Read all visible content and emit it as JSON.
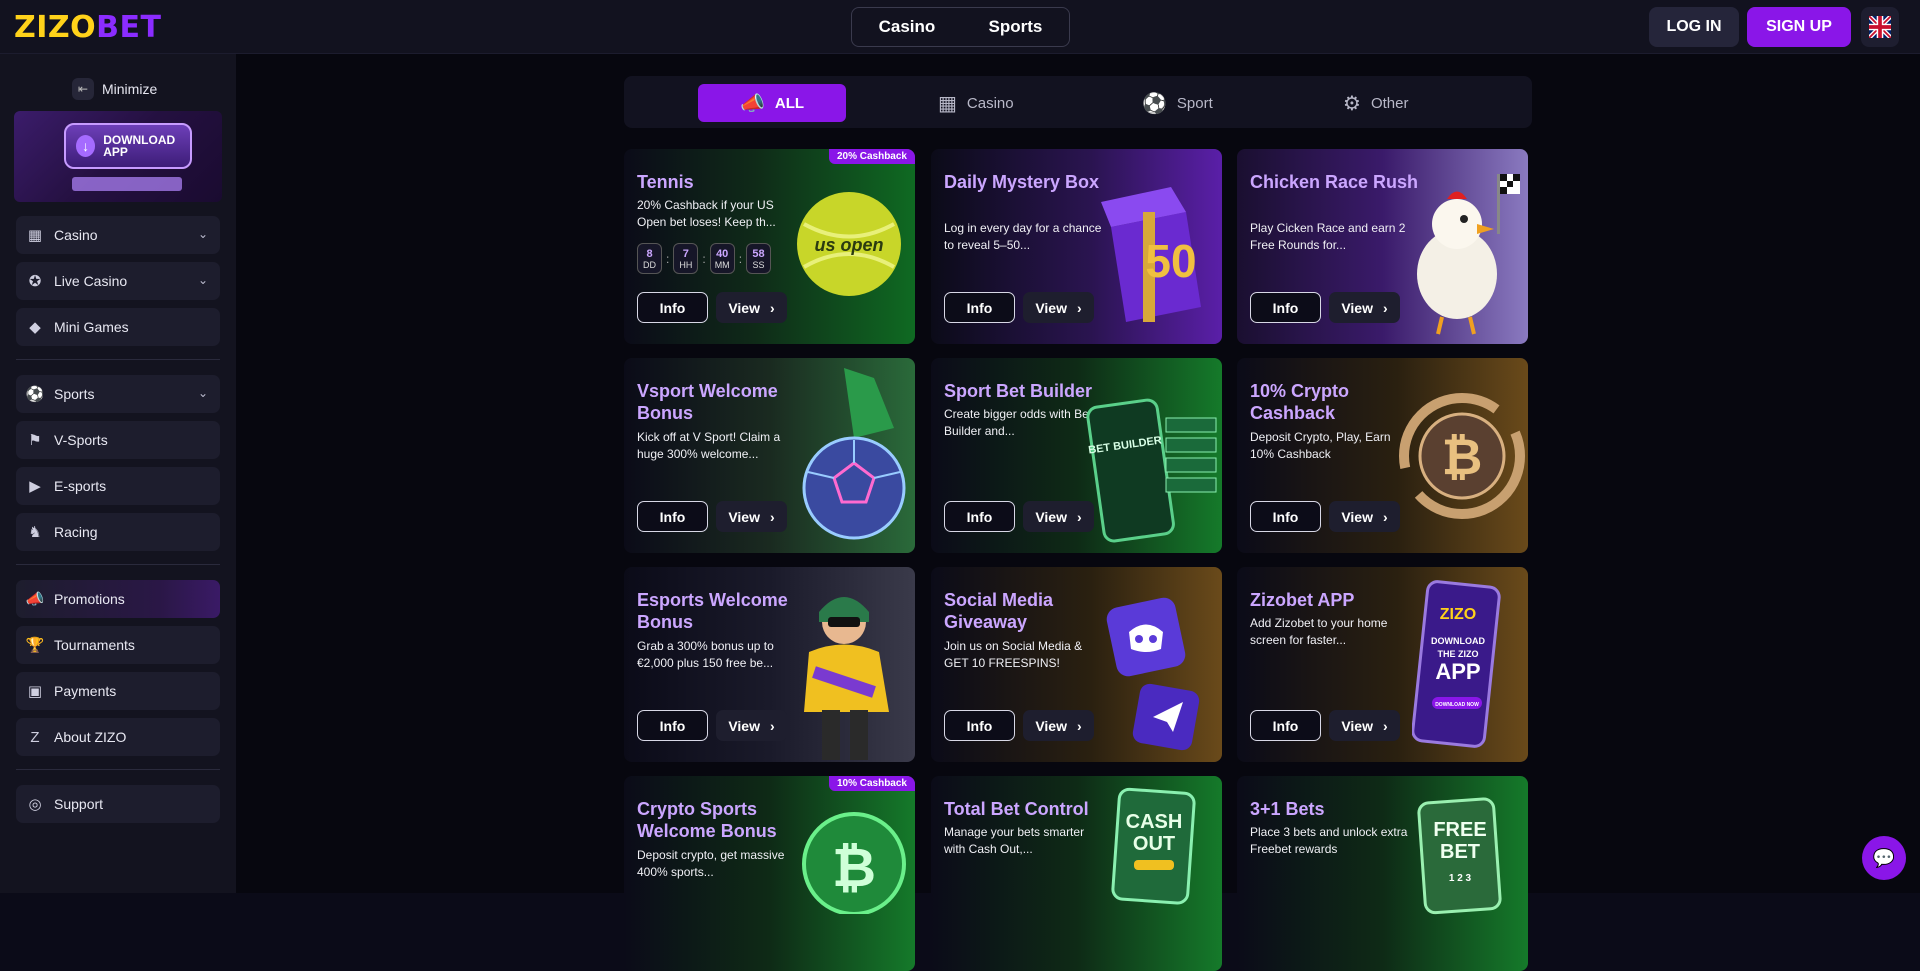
{
  "header": {
    "logo_part1": "ZIZO",
    "logo_part2": "BET",
    "nav": [
      "Casino",
      "Sports"
    ],
    "login": "LOG IN",
    "signup": "SIGN UP",
    "flag_icon": "uk-flag-icon"
  },
  "sidebar": {
    "minimize": "Minimize",
    "download": "DOWNLOAD APP",
    "items": [
      {
        "label": "Casino",
        "icon": "casino-icon",
        "chevron": true
      },
      {
        "label": "Live Casino",
        "icon": "live-casino-icon",
        "chevron": true
      },
      {
        "label": "Mini Games",
        "icon": "diamond-icon",
        "chevron": false
      },
      {
        "label": "Sports",
        "icon": "soccer-icon",
        "chevron": true
      },
      {
        "label": "V-Sports",
        "icon": "vsports-icon",
        "chevron": false
      },
      {
        "label": "E-sports",
        "icon": "play-icon",
        "chevron": false
      },
      {
        "label": "Racing",
        "icon": "horse-icon",
        "chevron": false
      },
      {
        "label": "Promotions",
        "icon": "megaphone-icon",
        "chevron": false
      },
      {
        "label": "Tournaments",
        "icon": "trophy-icon",
        "chevron": false
      },
      {
        "label": "Payments",
        "icon": "wallet-icon",
        "chevron": false
      },
      {
        "label": "About ZIZO",
        "icon": "zizo-icon",
        "chevron": false
      },
      {
        "label": "Support",
        "icon": "support-icon",
        "chevron": false
      }
    ]
  },
  "filters": {
    "tabs": [
      "ALL",
      "Casino",
      "Sport",
      "Other"
    ],
    "active": "ALL"
  },
  "buttons": {
    "info": "Info",
    "view": "View"
  },
  "cards": [
    {
      "title": "Tennis",
      "desc": "20% Cashback if your US Open bet loses! Keep th...",
      "tag": "20% Cashback",
      "timer": [
        {
          "n": "8",
          "u": "DD"
        },
        {
          "n": "7",
          "u": "HH"
        },
        {
          "n": "40",
          "u": "MM"
        },
        {
          "n": "58",
          "u": "SS"
        }
      ]
    },
    {
      "title": "Daily Mystery Box",
      "desc": "Log in every day for a chance to reveal 5–50..."
    },
    {
      "title": "Chicken Race Rush",
      "desc": "Play Cicken Race and earn 2 Free Rounds for..."
    },
    {
      "title": "Vsport Welcome Bonus",
      "desc": "Kick off at V Sport! Claim a huge 300% welcome..."
    },
    {
      "title": "Sport Bet Builder",
      "desc": "Create bigger odds with Bet Builder and..."
    },
    {
      "title": "10% Crypto Cashback",
      "desc": "Deposit Crypto, Play, Earn 10% Cashback"
    },
    {
      "title": "Esports Welcome Bonus",
      "desc": "Grab a 300% bonus up to €2,000 plus 150 free be..."
    },
    {
      "title": "Social Media Giveaway",
      "desc": "Join us on Social Media & GET 10 FREESPINS!"
    },
    {
      "title": "Zizobet APP",
      "desc": "Add Zizobet to your home screen for faster..."
    },
    {
      "title": "Crypto Sports Welcome Bonus",
      "desc": "Deposit crypto, get massive 400% sports...",
      "tag": "10% Cashback"
    },
    {
      "title": "Total Bet Control",
      "desc": "Manage your bets smarter with Cash Out,..."
    },
    {
      "title": "3+1 Bets",
      "desc": "Place 3 bets and unlock extra Freebet rewards"
    }
  ],
  "art": {
    "tennis_ball": "us open",
    "mystery_box": "50",
    "bet_builder": "BET BUILDER",
    "crypto_coin": "₿",
    "app_phone_brand": "ZIZO",
    "app_phone_line1": "DOWNLOAD",
    "app_phone_line2": "THE ZIZO",
    "app_phone_line3": "APP",
    "app_phone_button": "DOWNLOAD NOW",
    "cashout_line1": "CASH",
    "cashout_line2": "OUT",
    "freebet_line1": "FREE",
    "freebet_line2": "BET",
    "freebet_numbers": "1 2 3"
  }
}
